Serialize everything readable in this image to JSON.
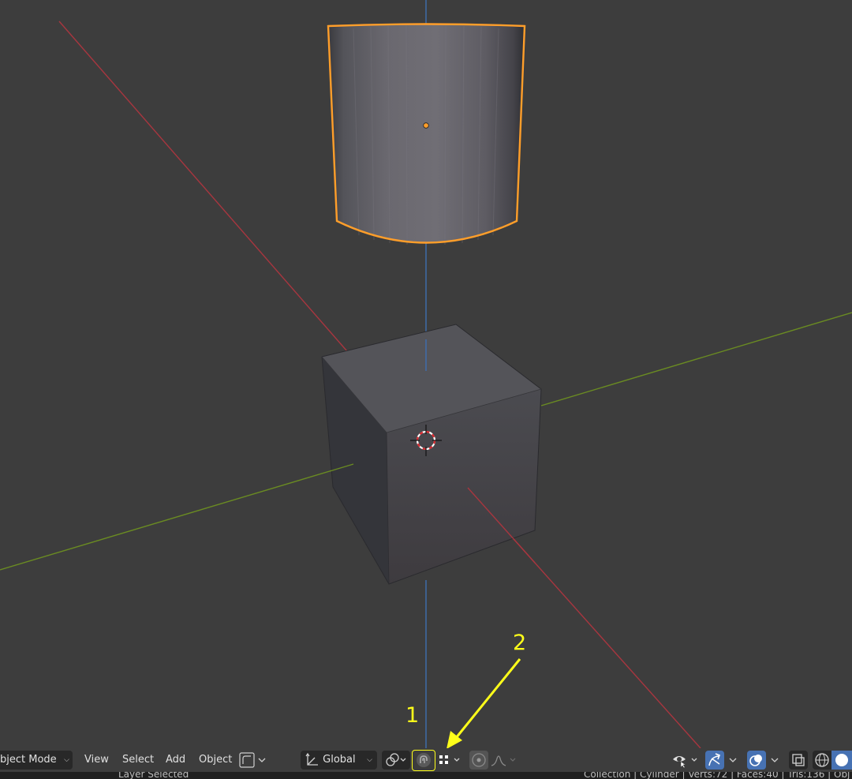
{
  "header": {
    "mode_label": "bject Mode",
    "menus": [
      "View",
      "Select",
      "Add",
      "Object"
    ],
    "orientation_label": "Global"
  },
  "annotations": {
    "label_1": "1",
    "label_2": "2",
    "color": "#ffff1a"
  },
  "status_bar": {
    "left_text": "Layer Selected",
    "right_text": "Collection | Cylinder | Verts:72 | Faces:40 | Tris:136 | Obj"
  },
  "colors": {
    "viewport_bg": "#3d3d3d",
    "x_axis": "#a8363f",
    "y_axis": "#6a8b22",
    "z_axis": "#3e6fb0",
    "selection_outline": "#ff9e2a",
    "active_button": "#4772b3"
  },
  "icons": {
    "editor_type": "cube-pivot-icon",
    "orientation": "transform-axes-icon",
    "pivot": "pivot-link-icon",
    "snap": "magnet-snap-icon",
    "snap_target": "snap-grid-icon",
    "proportional": "proportional-edit-icon",
    "falloff": "falloff-curve-icon",
    "visibility": "eye-selectable-icon",
    "gizmo": "gizmo-arrow-icon",
    "overlays": "overlay-circles-icon",
    "xray": "xray-toggle-icon",
    "wireframe": "wireframe-shading-icon",
    "solid": "solid-shading-icon"
  }
}
